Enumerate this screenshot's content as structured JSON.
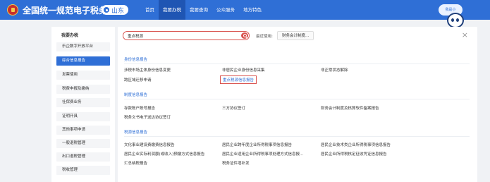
{
  "header": {
    "title": "全国统一规范电子税务局",
    "region": "山东",
    "nav": [
      "首页",
      "我要办税",
      "我要查询",
      "公众服务",
      "地方特色"
    ],
    "active_nav": 1,
    "mascot_text": "我是小"
  },
  "sidebar": {
    "heading": "我要办税",
    "items": [
      "乐企数字开放平台",
      "综合信息报告",
      "发票使用",
      "税费申报及缴纳",
      "社保费业务",
      "证明开具",
      "其他事项申请",
      "一般退税管理",
      "出口退税管理",
      "税收管理"
    ],
    "active_index": 1
  },
  "search": {
    "value": "重点税源",
    "recent_label": "最近使用:",
    "recent_item": "财务会计制度..."
  },
  "sections": [
    {
      "title": "身份信息报告",
      "links": [
        "涉税市场主体身份信息变更",
        "非居民企业身份信息采集",
        "非正常状态解除",
        "跨区域迁移申请",
        "重点税源信息报告"
      ]
    },
    {
      "title": "制度信息报告",
      "links": [
        "存款账户账号报告",
        "三方协议签订",
        "财务会计制度及核算软件备案报告",
        "税务文书电子送达协议签订"
      ]
    },
    {
      "title": "税源信息报告",
      "links": [
        "文化事业建设费缴费信息报告",
        "居民企业跨年度企业所得税事项信息报告",
        "居民企业技术类企业所得税事项信息报告",
        "居民企业实际利润额(或收入)预缴方式信息报告",
        "居民企业适用企业所得税事项处理方式信息报...",
        "居民企业所得税核定征收凭证信息报告",
        "汇总纳税报告",
        "税务证件增补发"
      ]
    }
  ]
}
